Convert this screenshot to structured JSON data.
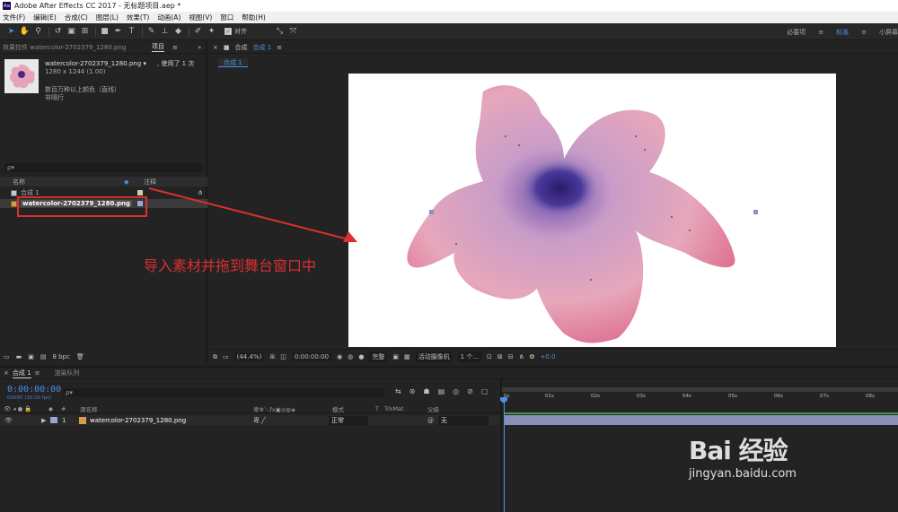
{
  "window": {
    "title": "Adobe After Effects CC 2017 - 无标题项目.aep *",
    "logo_text": "Ae"
  },
  "menu": {
    "items": [
      "文件(F)",
      "编辑(E)",
      "合成(C)",
      "图层(L)",
      "效果(T)",
      "动画(A)",
      "视图(V)",
      "窗口",
      "帮助(H)"
    ]
  },
  "toolbar": {
    "align_label": "对齐",
    "align_checked": "✓",
    "workspaces": [
      "必要项",
      "标准",
      "小屏幕"
    ],
    "active_workspace": "标准"
  },
  "left_panel": {
    "effects_tab": "效果控件 watercolor-2702379_1280.png",
    "project_tab": "项目",
    "menu_glyph": "≡",
    "more_glyph": "»",
    "file_name": "watercolor-2702379_1280.png ▾",
    "used_times": ", 使用了 1 次",
    "dimensions": "1280 x 1244 (1.00)",
    "colors": "数百万种以上颜色（直线）",
    "interlace": "非隔行",
    "search_placeholder": "ρ▾",
    "col_name": "名称",
    "col_comment": "注释",
    "items": [
      {
        "name": "合成 1"
      },
      {
        "name": "watercolor-2702379_1280.png"
      }
    ],
    "bpc": "8 bpc"
  },
  "comp_panel": {
    "tab_prefix": "合成",
    "tab_name": "合成 1",
    "tab_menu": "≡",
    "breadcrumb": "合成 1",
    "annotation": "导入素材并拖到舞台窗口中",
    "zoom": "(44.4%)",
    "timecode": "0:00:00:00",
    "quality": "完整",
    "camera": "活动摄像机",
    "views": "1 个...",
    "exposure": "+0.0"
  },
  "timeline": {
    "comp_tab": "合成 1",
    "render_queue_tab": "渲染队列",
    "timecode": "0:00:00:00",
    "timecode_sub": "00000 (30.00 fps)",
    "search_placeholder": "ρ▾",
    "col_source_name": "源名称",
    "col_mode": "模式",
    "col_t": "T",
    "col_trkmat": "TrkMat",
    "col_parent": "父级",
    "layer_number": "1",
    "layer_name": "watercolor-2702379_1280.png",
    "layer_mode": "正常",
    "layer_parent": "无",
    "ruler_ticks": [
      "0s",
      "01s",
      "02s",
      "03s",
      "04s",
      "05s",
      "06s",
      "07s",
      "08s"
    ]
  },
  "watermark": {
    "logo": "Bai 经验",
    "url": "jingyan.baidu.com"
  }
}
